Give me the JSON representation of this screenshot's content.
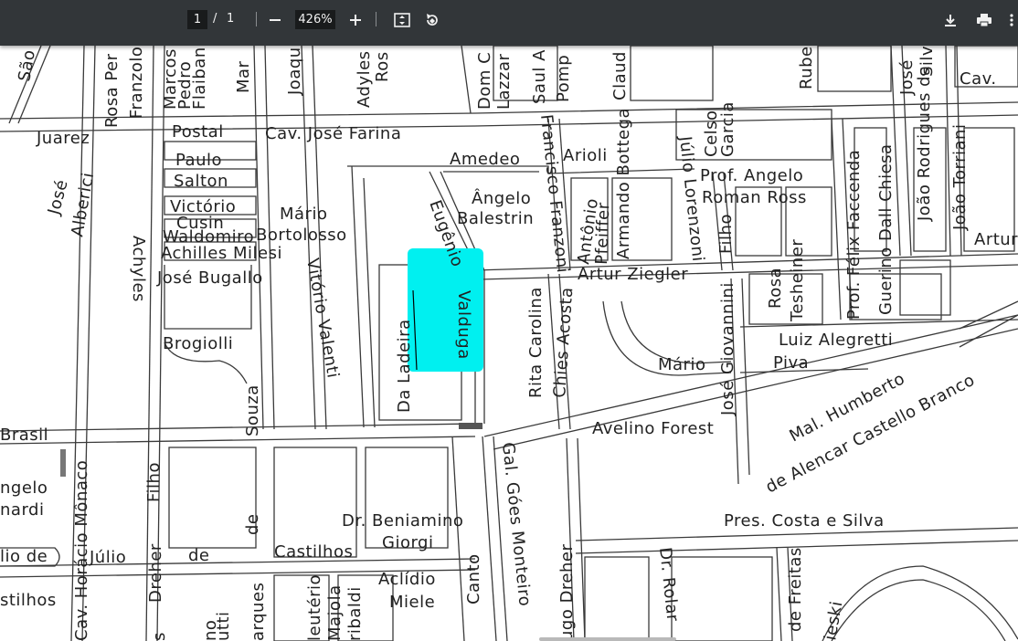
{
  "toolbar": {
    "page_current": "1",
    "page_sep": "/",
    "page_total": "1",
    "zoom_value": "426%",
    "icons": [
      "zoom-out-icon",
      "zoom-in-icon",
      "fit-page-icon",
      "rotate-icon",
      "download-icon",
      "print-icon",
      "more-icon"
    ]
  },
  "highlight_color": "#00f0f0",
  "map": {
    "labels": {
      "sao": "São",
      "rosa_per": "Rosa Per",
      "franzolos": "Franzolos",
      "marcos": "Marcos",
      "pedro": "Pedro",
      "flaiban": "Flaiban",
      "mar": "Mar",
      "joaqu": "Joaqu",
      "adyles": "Adyles",
      "ros": "Ros",
      "dom_c": "Dom C",
      "lazzar": "Lazzar",
      "saul_a": "Saul A",
      "pomp": "Pomp",
      "claud": "Claud",
      "rube": "Rube",
      "jose_top": "José",
      "silv": "Silv",
      "cav_top": "Cav.",
      "juarez": "Juarez",
      "postal": "Postal",
      "cav_jose_farina": "Cav. José Farina",
      "paulo": "Paulo",
      "salton": "Salton",
      "victorio": "Victório",
      "cusin": "Cusin",
      "waldomiro": "Waldomiro",
      "bortolosso": "Bortolosso",
      "mario_left": "Mário",
      "achilles_milesi": "Achilles Milesi",
      "jose_bugallo": "José Bugallo",
      "jose_left": "José",
      "alberici": "Alberici",
      "achyles": "Achyles",
      "brogiolli": "Brogiolli",
      "vitorio_valenti": "Vitório Valenti",
      "da_ladeira": "Da Ladeira",
      "eugenio": "Eugênio",
      "valduga": "Valduga",
      "amedeo": "Amedeo",
      "arioli": "Arioli",
      "angelo_balestrin_1": "Ângelo",
      "angelo_balestrin_2": "Balestrin",
      "francisco_franzoni": "Francisco Franzoni",
      "antonio_pfeiffer_1": "Antônio",
      "antonio_pfeiffer_2": "Pfeiffer",
      "armando_bottega": "Armando Bottega",
      "julio_lorenzoni": "Júlio Lorenzoni",
      "celso": "Celso",
      "garcia": "Garcia",
      "prof_angelo": "Prof. Angelo",
      "roman_ross": "Roman Ross",
      "filho_right": "Filho",
      "felix_faccenda": "Prof. Félix Faccenda",
      "guerino_dall_chiesa": "Guerino Dall Chiesa",
      "joao_rodrigues": "João Rodrigues da",
      "joao_torriani": "João Torriani",
      "artur": "Artur",
      "artur_ziegler": "Artur Ziegler",
      "rita_carolina": "Rita Carolina",
      "chies_acosta": "Chies Acosta",
      "jose_giovannini": "José Giovannini",
      "rosa": "Rosa",
      "tesheiner": "Tesheiner",
      "luiz_alegretti": "Luiz Alegretti",
      "mario_piva_1": "Mário",
      "mario_piva_2": "Piva",
      "avelino_forest": "Avelino Forest",
      "mal_humberto": "Mal. Humberto",
      "castello_branco": "de Alencar Castello Branco",
      "brasil": "Brasil",
      "angelo_left": "ngelo",
      "nardi": "nardi",
      "lio_de": "lio de",
      "stilhos": "stilhos",
      "horacio_monaco": "Cav. Horácio Mônaco",
      "julio": "Júlio",
      "dreher_left": "Dreher",
      "filho_left": "Filho",
      "de_left": "de",
      "souza": "Souza",
      "de_souza": "de",
      "castilhos": "Castilhos",
      "dr_beniamino": "Dr. Beniamino",
      "giorgi": "Giorgi",
      "aclidio": "Aclídio",
      "miele": "Miele",
      "canto": "Canto",
      "gal_goes_monteiro": "Gal. Góes Monteiro",
      "hugo_dreher": "ugo Dreher",
      "dr_rolar": "Dr. Rolar",
      "pres_costa_e_silva": "Pres. Costa e Silva",
      "freitas": "de Freitas",
      "ieski": "ieski",
      "s_bottom": "s",
      "no_bottom": "no",
      "utti": "utti",
      "arques": "arques",
      "leuterio": "leutério",
      "majola": "Majola",
      "ribaldi": "ribaldi"
    }
  }
}
